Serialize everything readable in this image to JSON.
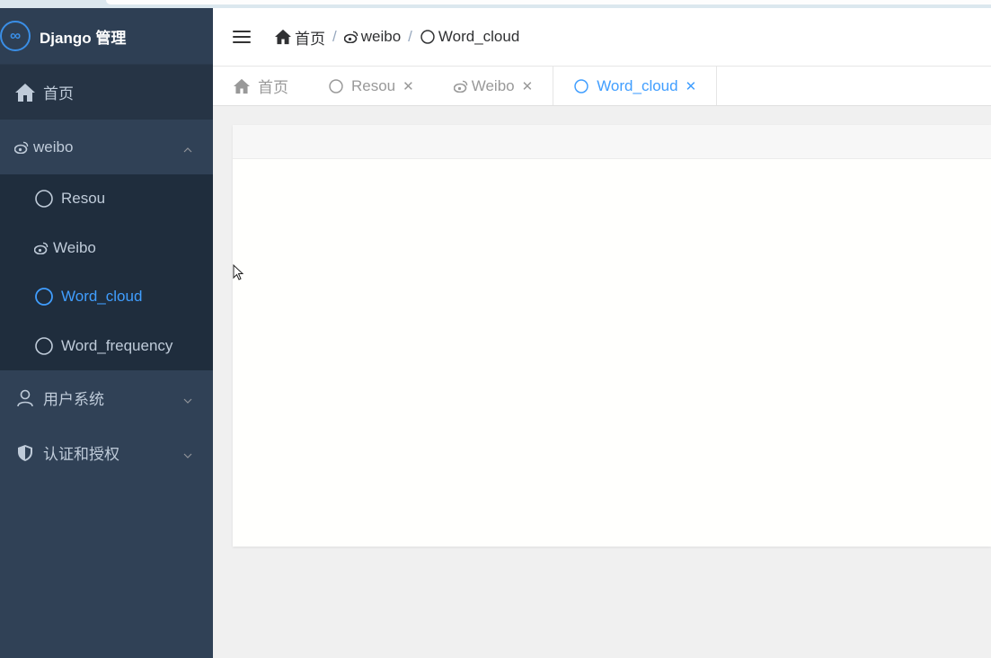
{
  "app": {
    "title": "Django 管理",
    "logo_glyph": "∞"
  },
  "sidebar": {
    "home": {
      "label": "首页",
      "icon": "home-icon"
    },
    "weibo_group": {
      "label": "weibo",
      "icon": "weibo-icon",
      "expanded": true,
      "items": [
        {
          "label": "Resou",
          "icon": "circle-icon",
          "active": false
        },
        {
          "label": "Weibo",
          "icon": "weibo-icon",
          "active": false
        },
        {
          "label": "Word_cloud",
          "icon": "circle-icon",
          "active": true
        },
        {
          "label": "Word_frequency",
          "icon": "circle-icon",
          "active": false
        }
      ]
    },
    "user_group": {
      "label": "用户系统",
      "icon": "user-icon",
      "expanded": false
    },
    "auth_group": {
      "label": "认证和授权",
      "icon": "shield-icon",
      "expanded": false
    }
  },
  "breadcrumb": [
    {
      "label": "首页",
      "icon": "home-icon"
    },
    {
      "label": "weibo",
      "icon": "weibo-icon"
    },
    {
      "label": "Word_cloud",
      "icon": "circle-icon"
    }
  ],
  "tabs": [
    {
      "label": "首页",
      "icon": "home-icon",
      "closable": false,
      "active": false
    },
    {
      "label": "Resou",
      "icon": "circle-icon",
      "closable": true,
      "active": false
    },
    {
      "label": "Weibo",
      "icon": "weibo-icon",
      "closable": true,
      "active": false
    },
    {
      "label": "Word_cloud",
      "icon": "circle-icon",
      "closable": true,
      "active": true
    }
  ],
  "colors": {
    "sidebar_bg": "#304156",
    "submenu_bg": "#1f2d3d",
    "accent": "#409eff",
    "text_muted": "#bfcbd9"
  }
}
